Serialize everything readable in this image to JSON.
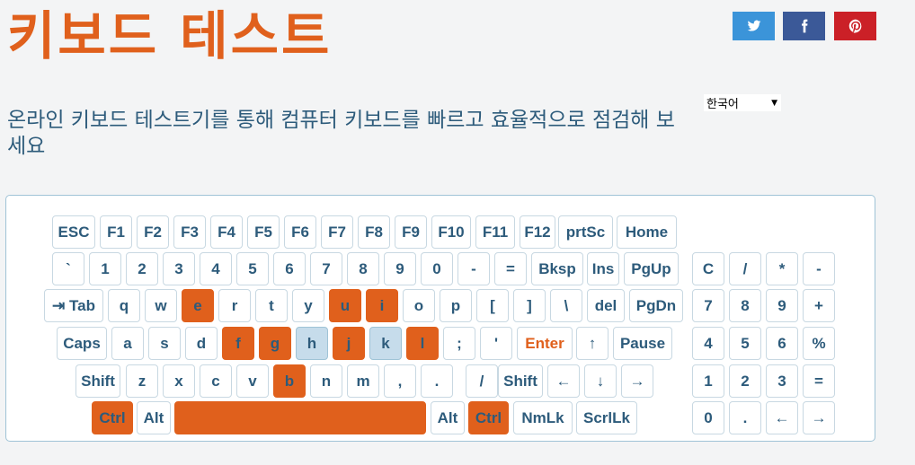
{
  "title": "키보드 테스트",
  "subtitle": "온라인 키보드 테스트기를 통해 컴퓨터 키보드를 빠르고 효율적으로 점검해 보세요",
  "language": {
    "selected": "한국어"
  },
  "share": [
    {
      "name": "twitter",
      "icon": "twitter-icon",
      "color": "#3b94d9"
    },
    {
      "name": "facebook",
      "icon": "facebook-icon",
      "color": "#3b5998"
    },
    {
      "name": "pinterest",
      "icon": "pinterest-icon",
      "color": "#cb2027"
    }
  ],
  "colors": {
    "accent": "#e0601c",
    "text": "#2d5b7b",
    "highlight": "#c6dceb",
    "border": "#9fc3d6"
  },
  "keys": {
    "esc": "ESC",
    "f1": "F1",
    "f2": "F2",
    "f3": "F3",
    "f4": "F4",
    "f5": "F5",
    "f6": "F6",
    "f7": "F7",
    "f8": "F8",
    "f9": "F9",
    "f10": "F10",
    "f11": "F11",
    "f12": "F12",
    "prtsc": "prtSc",
    "home": "Home",
    "backtick": "`",
    "d1": "1",
    "d2": "2",
    "d3": "3",
    "d4": "4",
    "d5": "5",
    "d6": "6",
    "d7": "7",
    "d8": "8",
    "d9": "9",
    "d0": "0",
    "minus": "-",
    "equals": "=",
    "bksp": "Bksp",
    "ins": "Ins",
    "pgup": "PgUp",
    "tab": "⇥ Tab",
    "q": "q",
    "w": "w",
    "e": "e",
    "r": "r",
    "t": "t",
    "y": "y",
    "u": "u",
    "i": "i",
    "o": "o",
    "p": "p",
    "lbracket": "[",
    "rbracket": "]",
    "backslash": "\\",
    "del": "del",
    "pgdn": "PgDn",
    "caps": "Caps",
    "a": "a",
    "s": "s",
    "d": "d",
    "f": "f",
    "g": "g",
    "h": "h",
    "j": "j",
    "k": "k",
    "l": "l",
    "semicolon": ";",
    "quote": "'",
    "enter": "Enter",
    "arrow_up": "↑",
    "pause": "Pause",
    "shift_l": "Shift",
    "z": "z",
    "x": "x",
    "c": "c",
    "v": "v",
    "b": "b",
    "n": "n",
    "m": "m",
    "comma": ",",
    "period": ".",
    "slash": "/",
    "shift_r": "Shift",
    "arrow_left": "←",
    "arrow_down": "↓",
    "arrow_right": "→",
    "ctrl_l": "Ctrl",
    "alt_l": "Alt",
    "space": "",
    "alt_r": "Alt",
    "ctrl_r": "Ctrl",
    "nmlk": "NmLk",
    "scrllk": "ScrlLk",
    "np_c": "C",
    "np_div": "/",
    "np_mul": "*",
    "np_sub": "-",
    "np_7": "7",
    "np_8": "8",
    "np_9": "9",
    "np_add": "+",
    "np_4": "4",
    "np_5": "5",
    "np_6": "6",
    "np_pct": "%",
    "np_1": "1",
    "np_2": "2",
    "np_3": "3",
    "np_eq": "=",
    "np_0": "0",
    "np_dot": ".",
    "np_left": "←",
    "np_right": "→"
  },
  "pressed_keys": [
    "e",
    "u",
    "i",
    "f",
    "g",
    "j",
    "l",
    "b",
    "ctrl_l",
    "space",
    "ctrl_r"
  ],
  "highlighted_keys": [
    "h",
    "k"
  ]
}
